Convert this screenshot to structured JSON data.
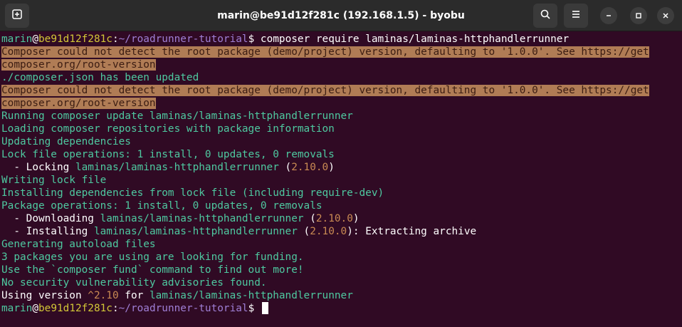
{
  "window": {
    "title": "marin@be91d12f281c (192.168.1.5) - byobu",
    "icons": {
      "new_tab": "new-tab-icon",
      "search": "search-icon",
      "menu": "hamburger-menu-icon",
      "minimize": "minimize-icon",
      "maximize": "maximize-icon",
      "close": "close-icon"
    }
  },
  "terminal": {
    "prompt_user": "marin",
    "prompt_at": "@",
    "prompt_host": "be91d12f281c",
    "prompt_colon": ":",
    "prompt_path": "~/roadrunner-tutorial",
    "prompt_symbol": "$ ",
    "command": "composer require laminas/laminas-httphandlerrunner",
    "warning_line1": "Composer could not detect the root package (demo/project) version, defaulting to '1.0.0'. See https://get",
    "warning_line2": "composer.org/root-version",
    "composer_json_updated": "./composer.json has been updated",
    "running_update": "Running composer update laminas/laminas-httphandlerrunner",
    "loading_repos": "Loading composer repositories with package information",
    "updating_deps": "Updating dependencies",
    "lock_ops": "Lock file operations: 1 install, 0 updates, 0 removals",
    "locking_prefix": "  - Locking ",
    "package_name": "laminas/laminas-httphandlerrunner",
    "version_open": " (",
    "version": "2.10.0",
    "version_close": ")",
    "writing_lock": "Writing lock file",
    "installing_deps": "Installing dependencies from lock file (including require-dev)",
    "package_ops": "Package operations: 1 install, 0 updates, 0 removals",
    "downloading_prefix": "  - Downloading ",
    "installing_prefix": "  - Installing ",
    "extracting_suffix": ": Extracting archive",
    "generating_autoload": "Generating autoload files",
    "funding_line": "3 packages you are using are looking for funding.",
    "fund_hint": "Use the `composer fund` command to find out more!",
    "no_advisories": "No security vulnerability advisories found.",
    "using_version_prefix": "Using version ",
    "using_version_value": "^2.10",
    "using_version_for": " for "
  },
  "colors": {
    "background": "#300a24",
    "titlebar": "#2b2b2b",
    "warning_bg": "#b07c55",
    "green": "#4ec9a0",
    "host_yellow": "#d2c637",
    "path_purple": "#9f7fd6",
    "version_orange": "#c98a53"
  }
}
